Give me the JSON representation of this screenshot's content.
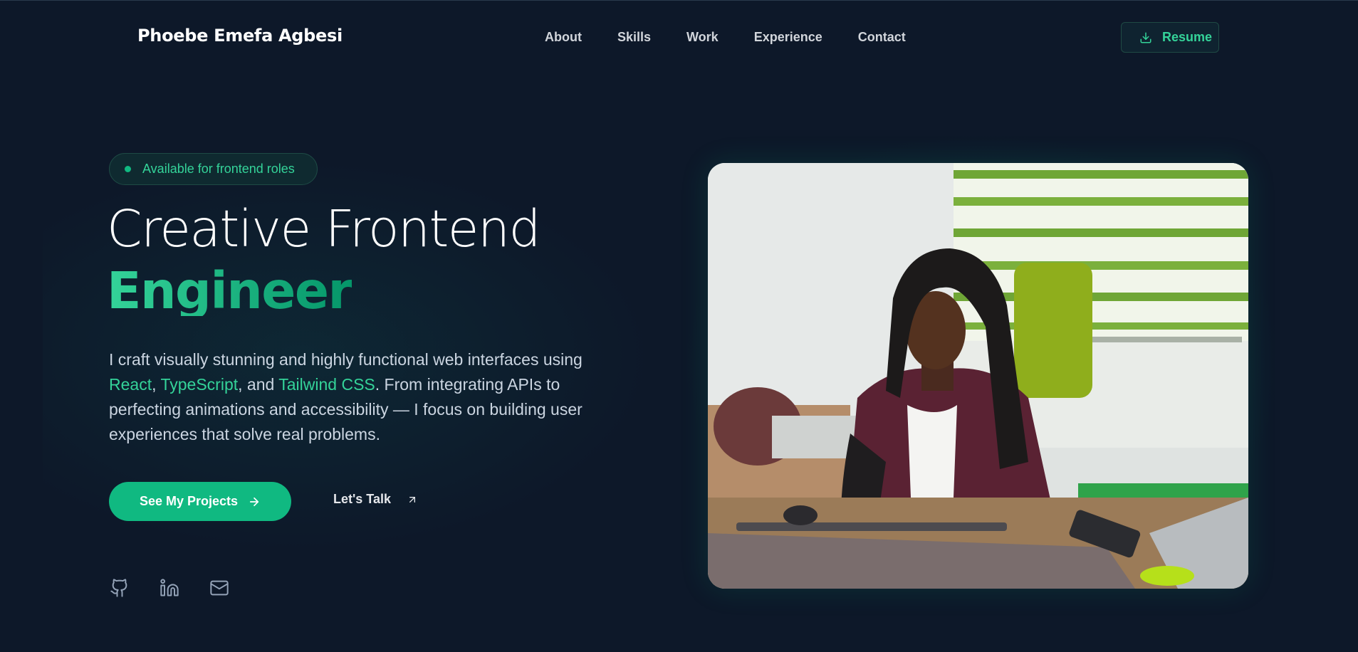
{
  "brand": {
    "name": "Phoebe Emefa Agbesi"
  },
  "nav": {
    "items": [
      {
        "label": "About"
      },
      {
        "label": "Skills"
      },
      {
        "label": "Work"
      },
      {
        "label": "Experience"
      },
      {
        "label": "Contact"
      }
    ],
    "resume": {
      "label": "Resume",
      "icon": "download-icon"
    }
  },
  "hero": {
    "badge": "Available for frontend roles",
    "title_line1": "Creative Frontend",
    "title_line2": "Engineer",
    "intro": {
      "p1": "I craft visually stunning and highly functional web interfaces using ",
      "react": "React",
      "sep1": ", ",
      "typescript": "TypeScript",
      "sep2": ", and ",
      "tailwind": "Tailwind CSS",
      "p2": ". From integrating APIs to perfecting animations and accessibility — I focus on building user experiences that solve real problems."
    },
    "primary_cta": {
      "label": "See My Projects",
      "icon": "arrow-right-icon"
    },
    "secondary_cta": {
      "label": "Let's Talk",
      "icon": "arrow-up-right-icon"
    },
    "socials": [
      "github-icon",
      "linkedin-icon",
      "mail-icon"
    ]
  },
  "colors": {
    "background": "#0d1829",
    "accent": "#10b981",
    "accent_text": "#34d399"
  }
}
